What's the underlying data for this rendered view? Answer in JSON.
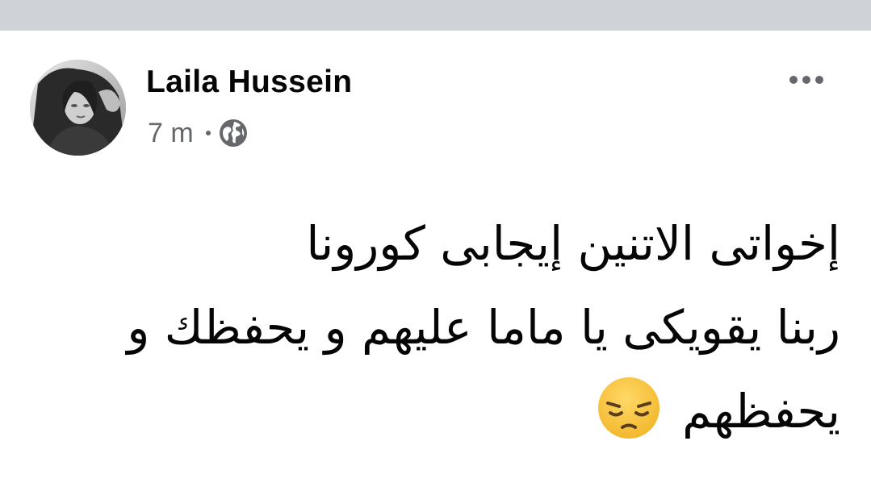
{
  "post": {
    "author_name": "Laila Hussein",
    "timestamp": "7 m",
    "privacy_icon": "globe-icon",
    "more_icon": "more-options-icon",
    "text_lines": [
      "إخواتى الاتنين إيجابى كورونا",
      "ربنا يقويكى يا ماما عليهم و يحفظك و",
      "يحفظهم"
    ],
    "emoji": "pensive-face-emoji"
  },
  "colors": {
    "top_bar": "#cfd2d6",
    "name_text": "#050505",
    "secondary_text": "#65676b",
    "emoji_face": "#f7c83b"
  }
}
